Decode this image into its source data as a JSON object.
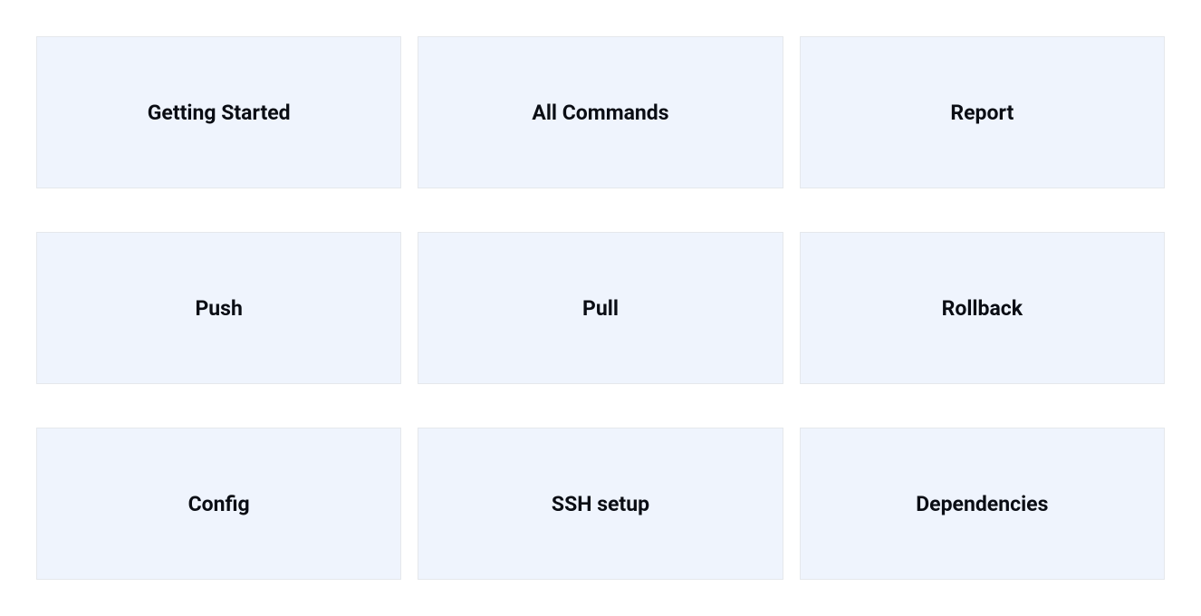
{
  "cards": [
    {
      "title": "Getting Started"
    },
    {
      "title": "All Commands"
    },
    {
      "title": "Report"
    },
    {
      "title": "Push"
    },
    {
      "title": "Pull"
    },
    {
      "title": "Rollback"
    },
    {
      "title": "Config"
    },
    {
      "title": "SSH setup"
    },
    {
      "title": "Dependencies"
    }
  ]
}
